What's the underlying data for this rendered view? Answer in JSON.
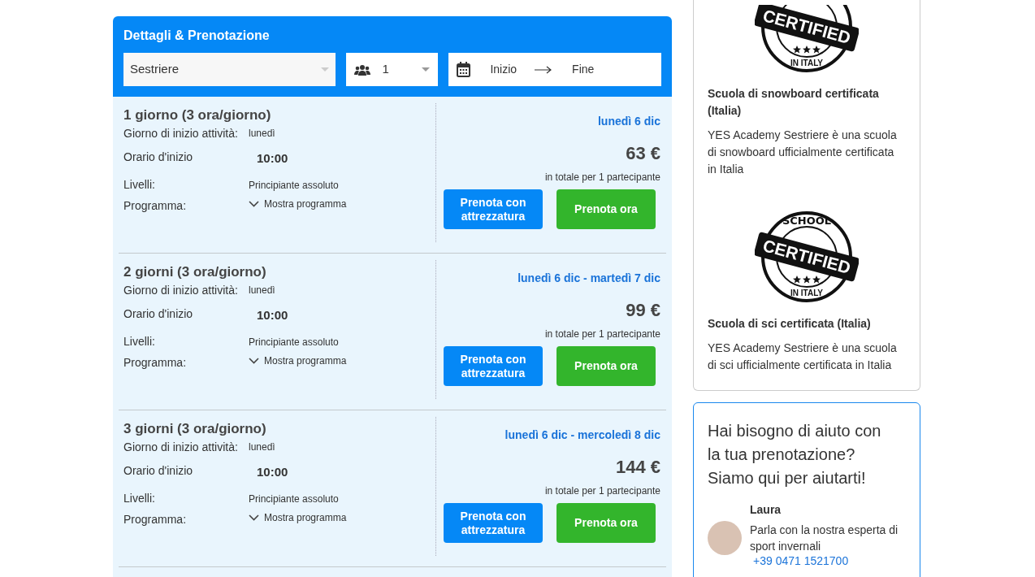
{
  "booking": {
    "title": "Dettagli & Prenotazione",
    "location": "Sestriere",
    "participants": "1",
    "date_start": "Inizio",
    "date_end": "Fine"
  },
  "options": [
    {
      "title": "1 giorno (3 ora/giorno)",
      "start_day_label": "Giorno di inizio attività:",
      "start_day": "lunedì",
      "start_time_label": "Orario d'inizio",
      "start_time": "10:00",
      "levels_label": "Livelli:",
      "levels": "Principiante assoluto",
      "program_label": "Programma:",
      "program_link": "Mostra programma",
      "dates": "lunedì 6 dic",
      "price": "63 €",
      "price_note": "in totale per 1 partecipante",
      "equipment_button": "Prenota con attrezzatura",
      "book_button": "Prenota ora"
    },
    {
      "title": "2 giorni (3 ora/giorno)",
      "start_day_label": "Giorno di inizio attività:",
      "start_day": "lunedì",
      "start_time_label": "Orario d'inizio",
      "start_time": "10:00",
      "levels_label": "Livelli:",
      "levels": "Principiante assoluto",
      "program_label": "Programma:",
      "program_link": "Mostra programma",
      "dates": "lunedì 6 dic - martedì 7 dic",
      "price": "99 €",
      "price_note": "in totale per 1 partecipante",
      "equipment_button": "Prenota con attrezzatura",
      "book_button": "Prenota ora"
    },
    {
      "title": "3 giorni (3 ora/giorno)",
      "start_day_label": "Giorno di inizio attività:",
      "start_day": "lunedì",
      "start_time_label": "Orario d'inizio",
      "start_time": "10:00",
      "levels_label": "Livelli:",
      "levels": "Principiante assoluto",
      "program_label": "Programma:",
      "program_link": "Mostra programma",
      "dates": "lunedì 6 dic - mercoledì 8 dic",
      "price": "144 €",
      "price_note": "in totale per 1 partecipante",
      "equipment_button": "Prenota con attrezzatura",
      "book_button": "Prenota ora"
    }
  ],
  "certifications": [
    {
      "stamp": {
        "band": "CERTIFIED",
        "bottom": "IN ITALY"
      },
      "title": "Scuola di snowboard certificata (Italia)",
      "text": "YES Academy Sestriere è una scuola di snowboard ufficialmente certificata in Italia"
    },
    {
      "stamp": {
        "top": "SCHOOL",
        "band": "CERTIFIED",
        "bottom": "IN ITALY"
      },
      "title": "Scuola di sci certificata (Italia)",
      "text": "YES Academy Sestriere è una scuola di sci ufficialmente certificata in Italia"
    }
  ],
  "help": {
    "title": "Hai bisogno di aiuto con la tua prenotazione? Siamo qui per aiutarti!",
    "name": "Laura",
    "text": "Parla con la nostra esperta di sport invernali",
    "phone": "+39 0471 1521700"
  }
}
